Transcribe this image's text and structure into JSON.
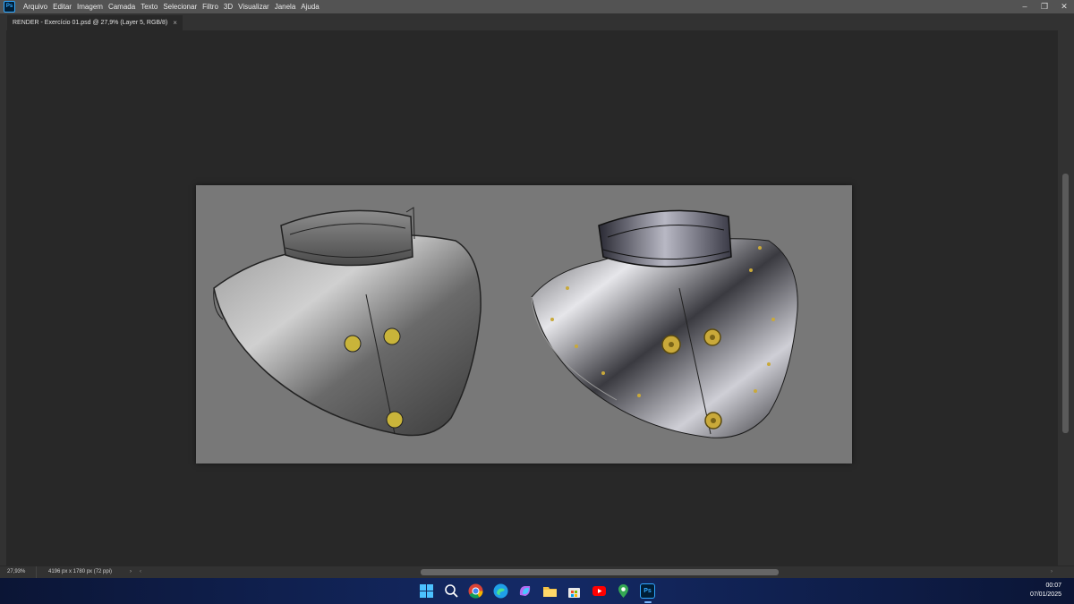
{
  "app": {
    "logo_text": "Ps",
    "menu": [
      "Arquivo",
      "Editar",
      "Imagem",
      "Camada",
      "Texto",
      "Selecionar",
      "Filtro",
      "3D",
      "Visualizar",
      "Janela",
      "Ajuda"
    ]
  },
  "window_controls": {
    "minimize": "–",
    "restore": "❐",
    "close": "✕"
  },
  "document_tab": {
    "title": "RENDER - Exercício 01.psd @ 27,9% (Layer 5, RGB/8)",
    "close": "×"
  },
  "status": {
    "zoom": "27,93%",
    "doc_size": "4196 px x 1780 px (72 ppi)",
    "arrow": "›",
    "scroll_left": "‹",
    "scroll_right": "›"
  },
  "taskbar": {
    "icons": [
      "windows-start-icon",
      "search-icon",
      "chrome-icon",
      "edge-icon",
      "copilot-icon",
      "file-explorer-icon",
      "store-icon",
      "youtube-icon",
      "maps-icon",
      "photoshop-icon"
    ],
    "photoshop_label": "Ps",
    "time": "00:07",
    "date": "07/01/2025"
  },
  "colors": {
    "ui_dark": "#282828",
    "ui_panel": "#323232",
    "menubar": "#535353",
    "canvas_bg": "#787878",
    "ps_blue": "#31a8ff",
    "brass": "#c9a93a"
  }
}
